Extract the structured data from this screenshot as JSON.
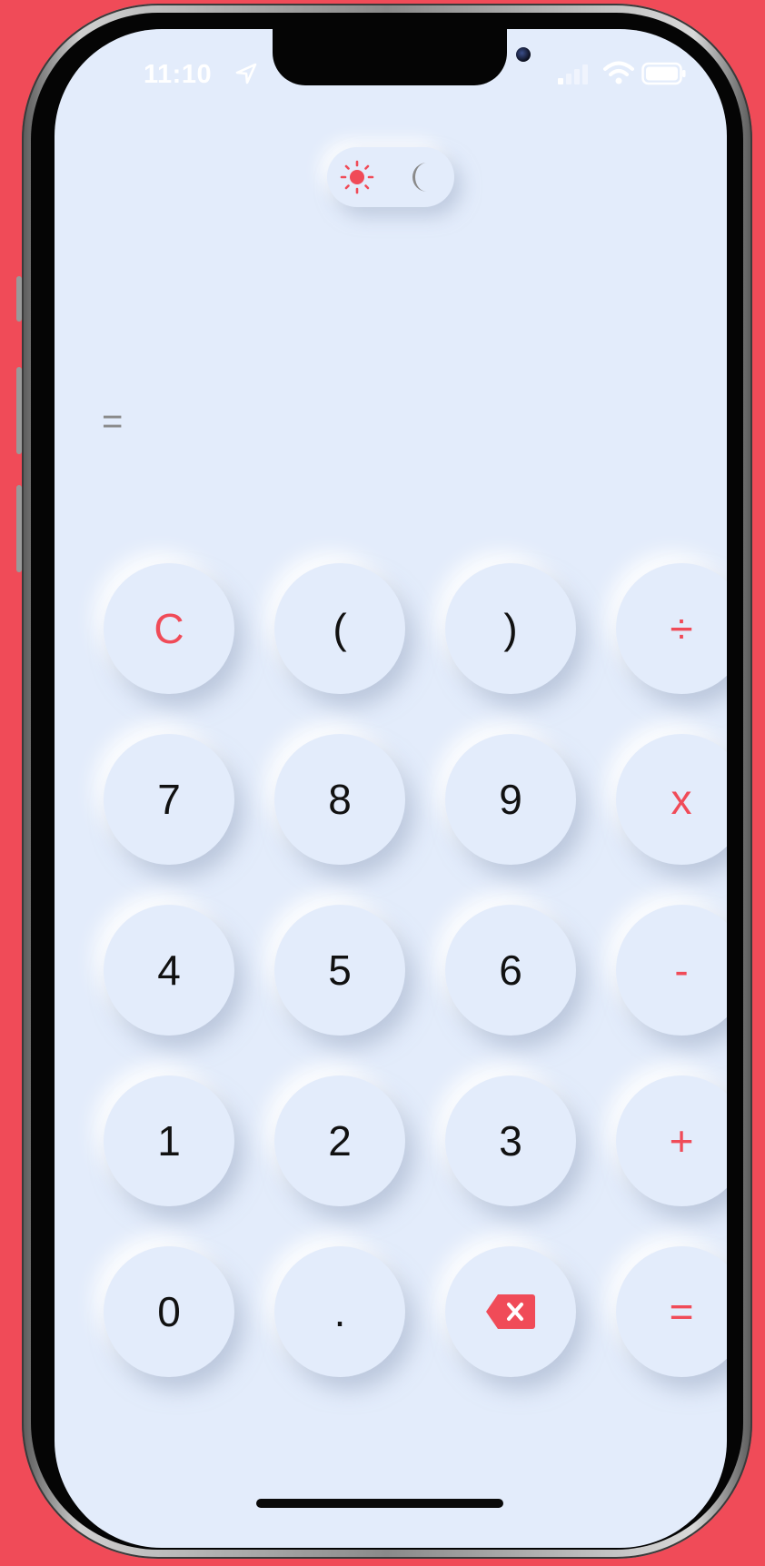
{
  "status_bar": {
    "time": "11:10",
    "icons": [
      "location-arrow-icon",
      "cellular-signal-icon",
      "wifi-icon",
      "battery-icon"
    ]
  },
  "theme_toggle": {
    "light_icon": "sun-icon",
    "dark_icon": "moon-icon",
    "selected": "light"
  },
  "display": {
    "result": "="
  },
  "keypad": [
    {
      "label": "C",
      "type": "op"
    },
    {
      "label": "(",
      "type": "num"
    },
    {
      "label": ")",
      "type": "num"
    },
    {
      "label": "÷",
      "type": "op"
    },
    {
      "label": "7",
      "type": "num"
    },
    {
      "label": "8",
      "type": "num"
    },
    {
      "label": "9",
      "type": "num"
    },
    {
      "label": "x",
      "type": "op"
    },
    {
      "label": "4",
      "type": "num"
    },
    {
      "label": "5",
      "type": "num"
    },
    {
      "label": "6",
      "type": "num"
    },
    {
      "label": "-",
      "type": "op"
    },
    {
      "label": "1",
      "type": "num"
    },
    {
      "label": "2",
      "type": "num"
    },
    {
      "label": "3",
      "type": "num"
    },
    {
      "label": "+",
      "type": "op"
    },
    {
      "label": "0",
      "type": "num"
    },
    {
      "label": ".",
      "type": "num"
    },
    {
      "label": "",
      "type": "delete",
      "icon": "backspace-icon"
    },
    {
      "label": "=",
      "type": "op"
    }
  ],
  "colors": {
    "background": "#f04b58",
    "screen": "#e3ecfb",
    "accent": "#f04b58",
    "digit": "#111111",
    "moon": "#8a8a8a"
  }
}
